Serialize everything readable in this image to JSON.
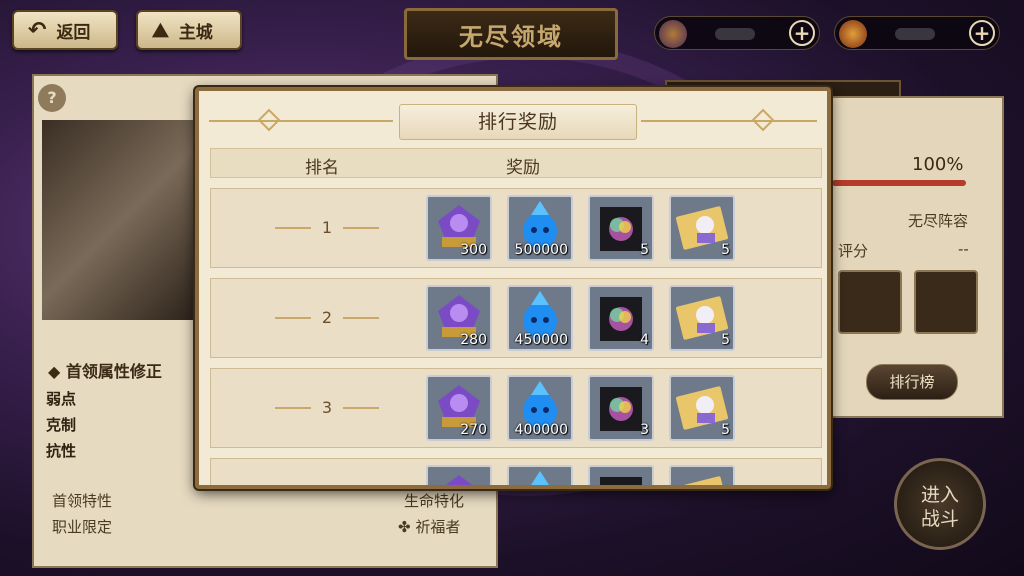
{
  "topbar": {
    "back_label": "返回",
    "home_label": "主城",
    "title": "无尽领域",
    "plus_symbol": "+"
  },
  "left_panel": {
    "help_symbol": "?",
    "section_title": "首领属性修正",
    "stat_labels": [
      "弱点",
      "克制",
      "抗性"
    ],
    "trait_label": "首领特性",
    "trait_value": "生命特化",
    "job_label": "职业限定",
    "job_value": "祈福者"
  },
  "right_panel": {
    "percent": "100%",
    "lineup": "无尽阵容",
    "score_label": "评分",
    "score_value": "--",
    "ranking_button": "排行榜"
  },
  "enter_button": {
    "line1": "进入",
    "line2": "战斗"
  },
  "modal": {
    "title": "排行奖励",
    "col_rank": "排名",
    "col_reward": "奖励",
    "rows": [
      {
        "rank": "1",
        "rewards": [
          {
            "icon": "purple-flower-icon",
            "count": "300"
          },
          {
            "icon": "blue-soul-icon",
            "count": "500000"
          },
          {
            "icon": "rainbow-cube-icon",
            "count": "5"
          },
          {
            "icon": "character-card-icon",
            "count": "5"
          }
        ]
      },
      {
        "rank": "2",
        "rewards": [
          {
            "icon": "purple-flower-icon",
            "count": "280"
          },
          {
            "icon": "blue-soul-icon",
            "count": "450000"
          },
          {
            "icon": "rainbow-cube-icon",
            "count": "4"
          },
          {
            "icon": "character-card-icon",
            "count": "5"
          }
        ]
      },
      {
        "rank": "3",
        "rewards": [
          {
            "icon": "purple-flower-icon",
            "count": "270"
          },
          {
            "icon": "blue-soul-icon",
            "count": "400000"
          },
          {
            "icon": "rainbow-cube-icon",
            "count": "3"
          },
          {
            "icon": "character-card-icon",
            "count": "5"
          }
        ]
      }
    ]
  },
  "colors": {
    "panel": "#e6dac0",
    "gold": "#c9a866",
    "text": "#4b3924"
  }
}
